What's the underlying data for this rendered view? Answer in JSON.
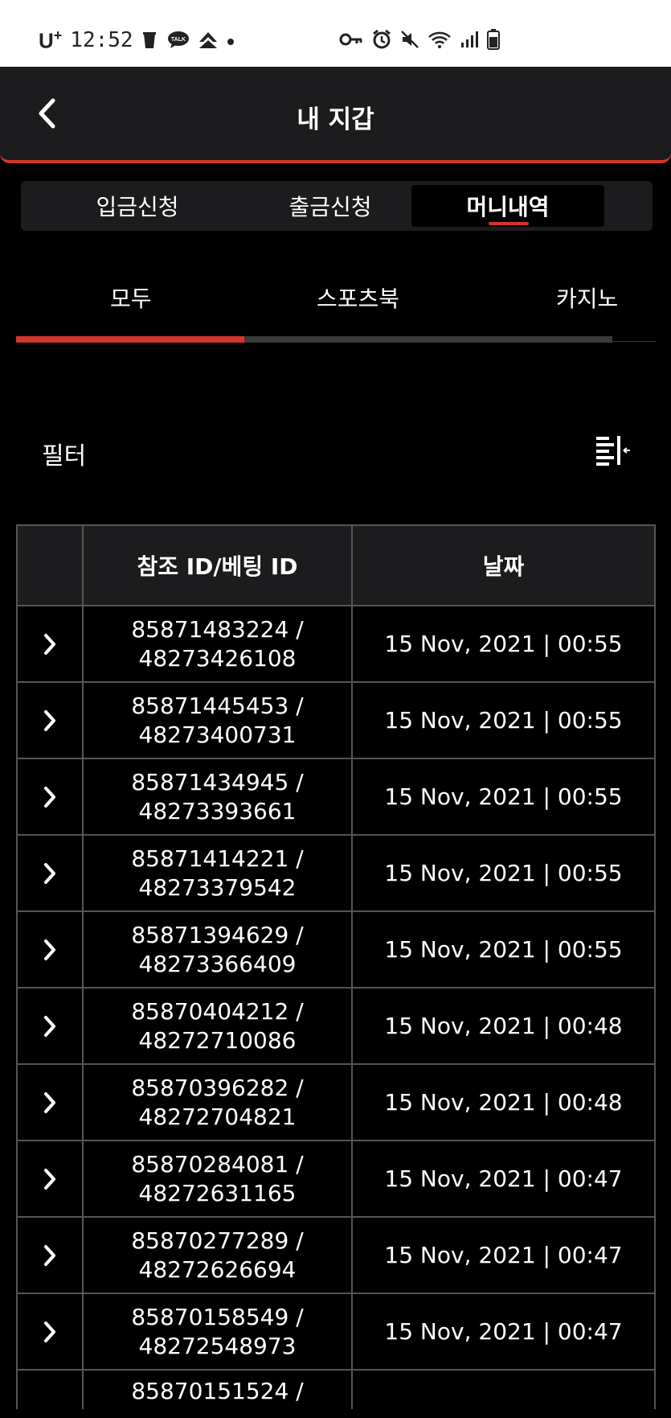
{
  "status_bar": {
    "carrier": "U",
    "carrier_sup": "+",
    "time": "12:52"
  },
  "header": {
    "title": "내 지갑"
  },
  "wallet_tabs": [
    {
      "label": "입금신청",
      "active": false
    },
    {
      "label": "출금신청",
      "active": false
    },
    {
      "label": "머니내역",
      "active": true
    }
  ],
  "category_tabs": [
    {
      "label": "모두",
      "active": true
    },
    {
      "label": "스포츠북",
      "active": false
    },
    {
      "label": "카지노",
      "active": false
    }
  ],
  "filter": {
    "label": "필터"
  },
  "table": {
    "headers": [
      "",
      "참조 ID/베팅 ID",
      "날짜"
    ],
    "rows": [
      {
        "ref_id": "85871483224 /",
        "bet_id": "48273426108",
        "date": "15 Nov, 2021 | 00:55"
      },
      {
        "ref_id": "85871445453 /",
        "bet_id": "48273400731",
        "date": "15 Nov, 2021 | 00:55"
      },
      {
        "ref_id": "85871434945 /",
        "bet_id": "48273393661",
        "date": "15 Nov, 2021 | 00:55"
      },
      {
        "ref_id": "85871414221 /",
        "bet_id": "48273379542",
        "date": "15 Nov, 2021 | 00:55"
      },
      {
        "ref_id": "85871394629 /",
        "bet_id": "48273366409",
        "date": "15 Nov, 2021 | 00:55"
      },
      {
        "ref_id": "85870404212 /",
        "bet_id": "48272710086",
        "date": "15 Nov, 2021 | 00:48"
      },
      {
        "ref_id": "85870396282 /",
        "bet_id": "48272704821",
        "date": "15 Nov, 2021 | 00:48"
      },
      {
        "ref_id": "85870284081 /",
        "bet_id": "48272631165",
        "date": "15 Nov, 2021 | 00:47"
      },
      {
        "ref_id": "85870277289 /",
        "bet_id": "48272626694",
        "date": "15 Nov, 2021 | 00:47"
      },
      {
        "ref_id": "85870158549 /",
        "bet_id": "48272548973",
        "date": "15 Nov, 2021 | 00:47"
      }
    ],
    "partial_row": {
      "ref_id": "85870151524 /"
    }
  },
  "icons": {
    "back": "chevron-left-icon",
    "row_expand": "chevron-right-icon",
    "filter": "filter-list-icon"
  }
}
